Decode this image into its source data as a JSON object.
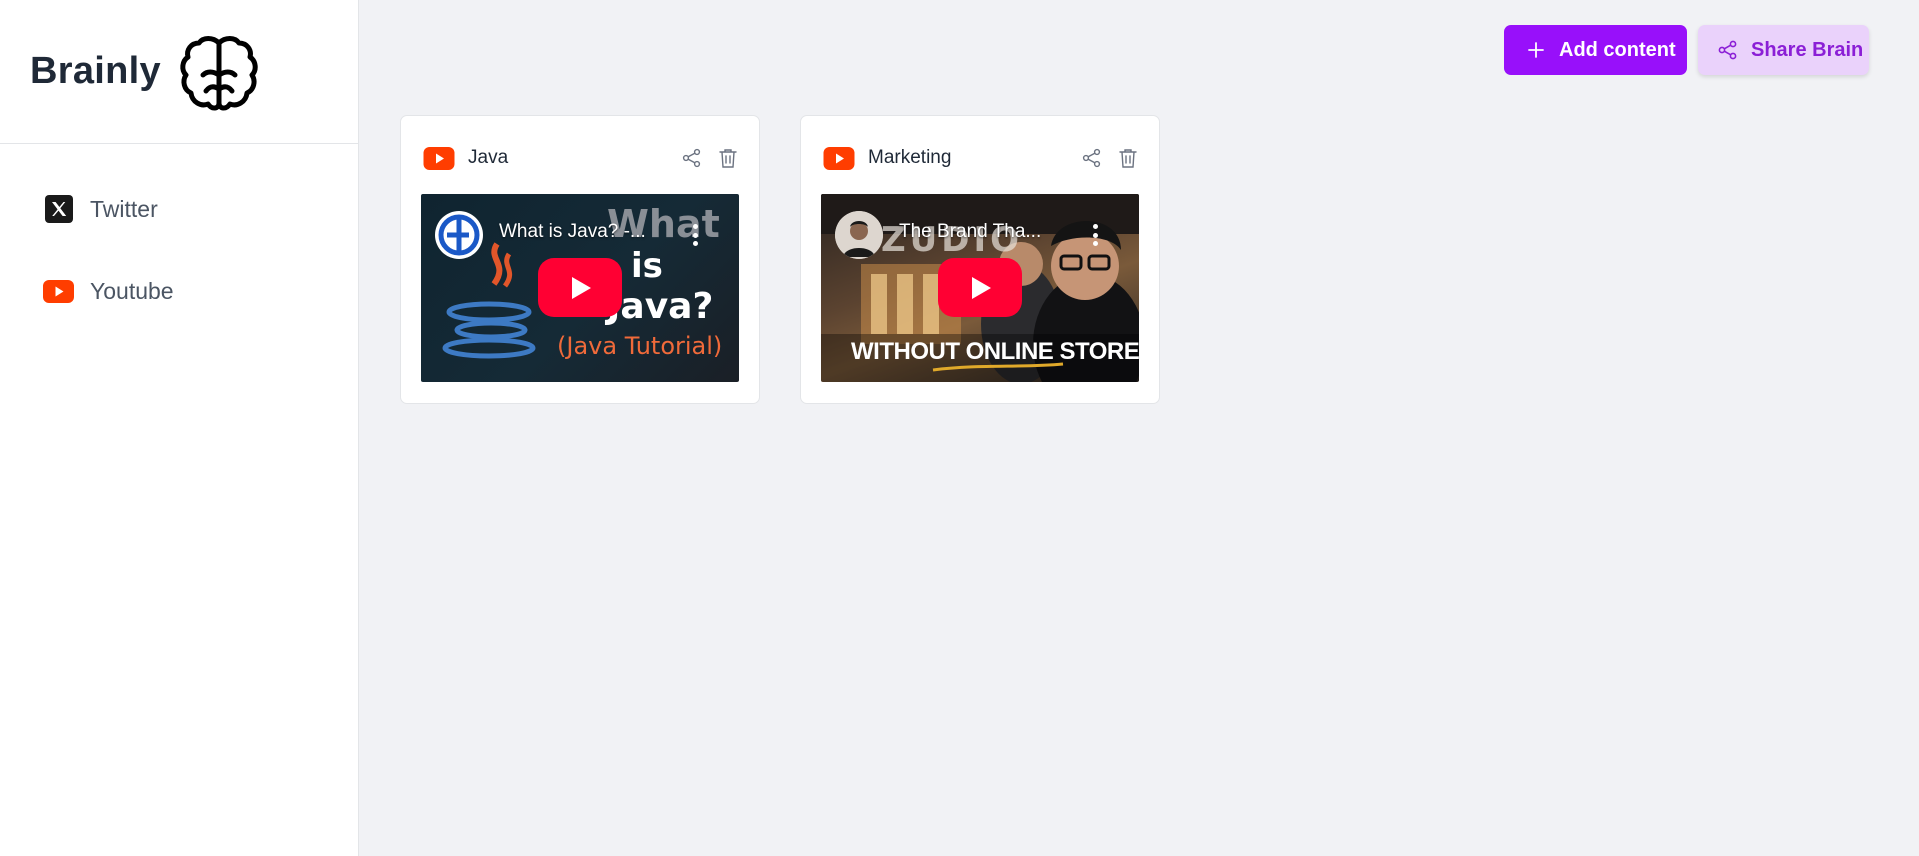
{
  "brand": {
    "name": "Brainly"
  },
  "sidebar": {
    "items": [
      {
        "label": "Twitter",
        "icon": "x-twitter-icon"
      },
      {
        "label": "Youtube",
        "icon": "youtube-icon"
      }
    ]
  },
  "toolbar": {
    "add_label": "Add content",
    "share_label": "Share Brain"
  },
  "cards": [
    {
      "title": "Java",
      "type_icon": "youtube-icon",
      "video_title": "What is Java? -...",
      "thumbnail_text": [
        "What",
        "is",
        "Java?",
        "(Java Tutorial)"
      ]
    },
    {
      "title": "Marketing",
      "type_icon": "youtube-icon",
      "video_title": "The Brand Tha...",
      "thumbnail_text": [
        "ZUDIO",
        "WITHOUT ONLINE STORES?"
      ]
    }
  ],
  "colors": {
    "accent": "#9810fa",
    "accent_soft": "#ead2fb",
    "youtube_red": "#ff3d00",
    "background": "#f1f2f5"
  }
}
